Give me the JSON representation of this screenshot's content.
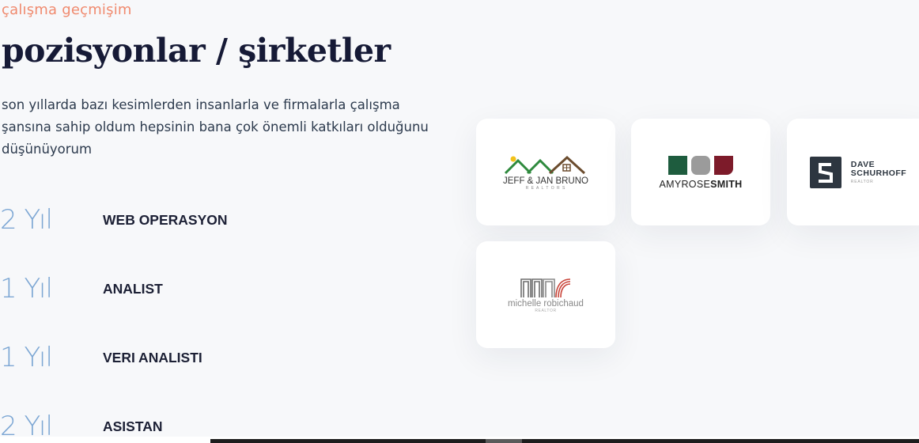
{
  "section": {
    "eyebrow": "çalışma geçmişim",
    "title": "pozisyonlar / şirketler",
    "intro": "son yıllarda bazı kesimlerden insanlarla ve firmalarla çalışma şansına sahip oldum hepsinin bana çok önemli katkıları olduğunu düşünüyorum"
  },
  "experience": [
    {
      "years": "2 Yıl",
      "title": "WEB OPERASYON"
    },
    {
      "years": "1 Yıl",
      "title": "ANALIST"
    },
    {
      "years": "1 Yıl",
      "title": "VERI ANALISTI"
    },
    {
      "years": "2 Yıl",
      "title": "ASISTAN"
    }
  ],
  "clients": {
    "jeff": {
      "line1": "JEFF & JAN BRUNO",
      "line2": "R E A L T O R S"
    },
    "amy": {
      "first": "AMYROSE",
      "last": "SMITH"
    },
    "dave": {
      "line1": "DAVE",
      "line2": "SCHURHOFF",
      "line3": "REALTOR"
    },
    "michelle": {
      "name": "michelle robichaud",
      "sub": "REALTOR"
    }
  },
  "colors": {
    "accent": "#f08a6e",
    "years": "#7da7d4",
    "heading": "#161a36"
  }
}
